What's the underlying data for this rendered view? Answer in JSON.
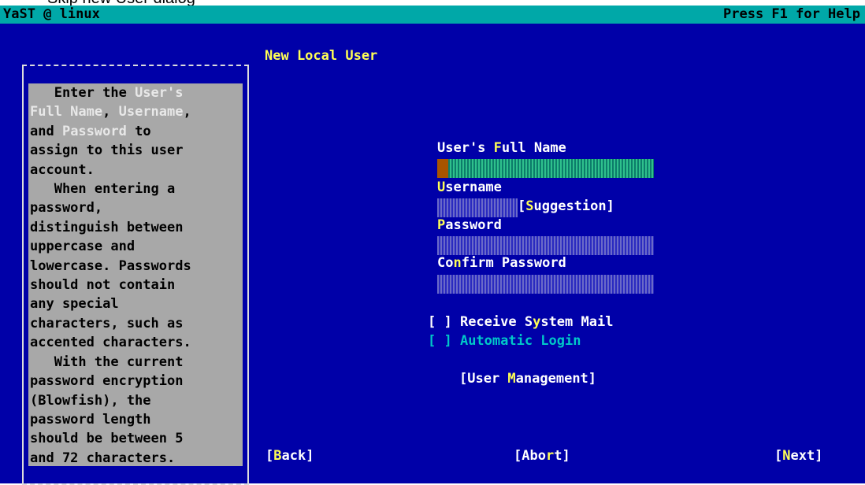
{
  "caption": "Skip new User dialog",
  "topbar": {
    "left": "YaST @ linux",
    "right": "Press F1 for Help"
  },
  "dialog_title": "New Local User",
  "help_lines": [
    {
      "parts": [
        {
          "t": "   Enter the "
        },
        {
          "t": "User's",
          "hl": true
        }
      ]
    },
    {
      "parts": [
        {
          "t": "Full Name",
          "hl": true
        },
        {
          "t": ", "
        },
        {
          "t": "Username",
          "hl": true
        },
        {
          "t": ","
        }
      ]
    },
    {
      "parts": [
        {
          "t": "and "
        },
        {
          "t": "Password",
          "hl": true
        },
        {
          "t": " to"
        }
      ]
    },
    {
      "parts": [
        {
          "t": "assign to this user"
        }
      ]
    },
    {
      "parts": [
        {
          "t": "account."
        }
      ]
    },
    {
      "parts": [
        {
          "t": "   When entering a"
        }
      ]
    },
    {
      "parts": [
        {
          "t": "password,"
        }
      ]
    },
    {
      "parts": [
        {
          "t": "distinguish between"
        }
      ]
    },
    {
      "parts": [
        {
          "t": "uppercase and"
        }
      ]
    },
    {
      "parts": [
        {
          "t": "lowercase. Passwords"
        }
      ]
    },
    {
      "parts": [
        {
          "t": "should not contain"
        }
      ]
    },
    {
      "parts": [
        {
          "t": "any special"
        }
      ]
    },
    {
      "parts": [
        {
          "t": "characters, such as"
        }
      ]
    },
    {
      "parts": [
        {
          "t": "accented characters."
        }
      ]
    },
    {
      "parts": [
        {
          "t": "   With the current"
        }
      ]
    },
    {
      "parts": [
        {
          "t": "password encryption"
        }
      ]
    },
    {
      "parts": [
        {
          "t": "(Blowfish), the"
        }
      ]
    },
    {
      "parts": [
        {
          "t": "password length"
        }
      ]
    },
    {
      "parts": [
        {
          "t": "should be between 5"
        }
      ]
    },
    {
      "parts": [
        {
          "t": "and 72 characters."
        }
      ]
    }
  ],
  "form": {
    "full_name_label": {
      "pre": "User's ",
      "hk": "F",
      "post": "ull Name"
    },
    "full_name_value": "",
    "username_label": {
      "pre": "",
      "hk": "U",
      "post": "sername"
    },
    "username_value": "",
    "suggestion_button": {
      "pre": "[",
      "hk": "S",
      "post": "uggestion]"
    },
    "password_label": {
      "pre": "",
      "hk": "P",
      "post": "assword"
    },
    "password_value": "",
    "confirm_label": {
      "pre": "Co",
      "hk": "n",
      "post": "firm Password"
    },
    "confirm_value": "",
    "receive_mail": {
      "box": "[ ] ",
      "pre": "Receive S",
      "hk": "y",
      "post": "stem Mail",
      "checked": false
    },
    "auto_login": {
      "box": "[ ] ",
      "label": "Automatic Login",
      "checked": false
    },
    "user_mgmt_button": {
      "pre": "[User ",
      "hk": "M",
      "post": "anagement]"
    }
  },
  "buttons": {
    "back": {
      "pre": "[",
      "hk": "B",
      "post": "ack]"
    },
    "abort": {
      "pre": "[Abo",
      "hk": "r",
      "post": "t]"
    },
    "next": {
      "pre": "[",
      "hk": "N",
      "post": "ext]"
    }
  },
  "colors": {
    "screen_bg": "#0000a8",
    "topbar_bg": "#00a8a8",
    "hotkey": "#ffff54",
    "help_bg": "#a8a8a8",
    "focus_text": "#00c8c8",
    "cursor": "#a85400"
  }
}
